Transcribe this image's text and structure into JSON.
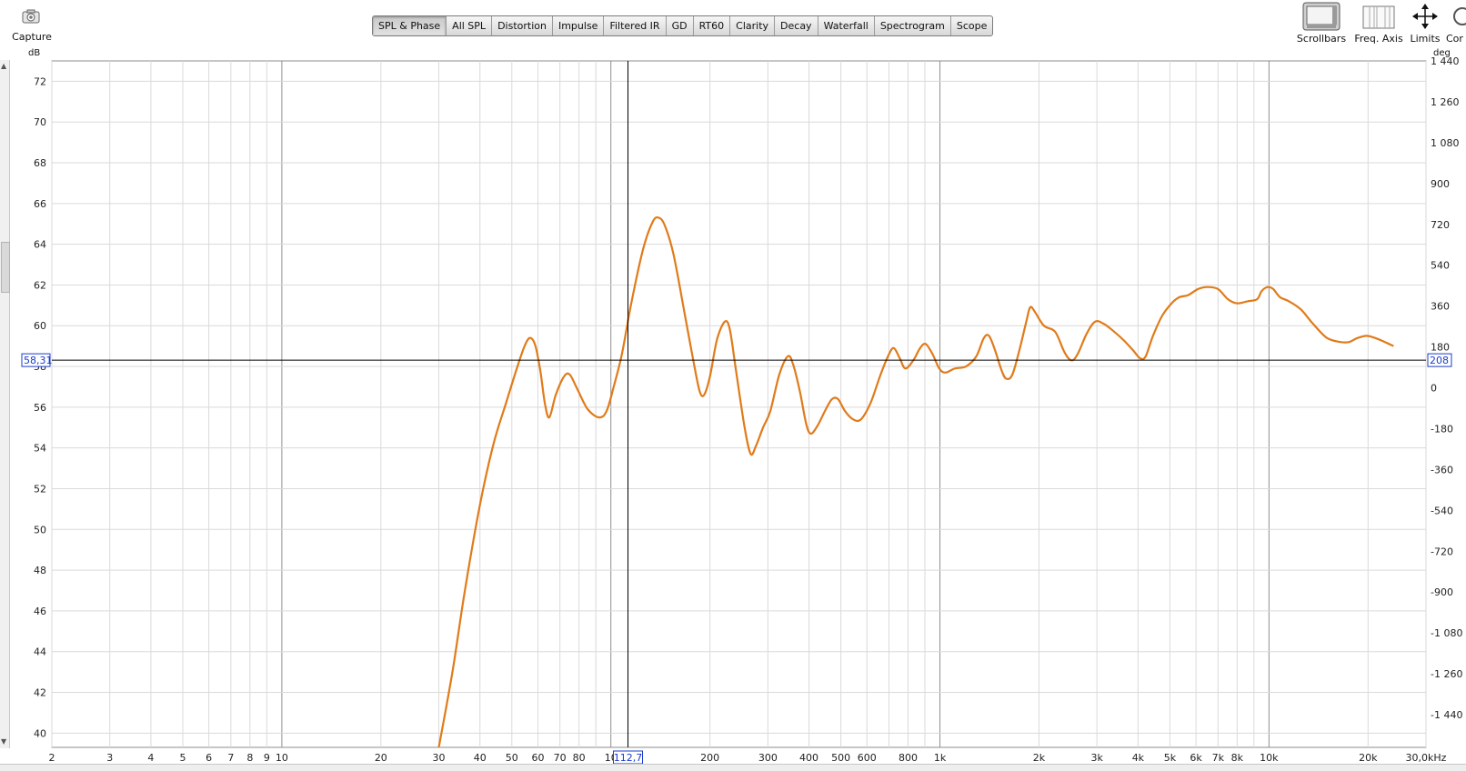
{
  "toolbar": {
    "capture_label": "Capture",
    "tabs": [
      {
        "label": "SPL & Phase",
        "active": true
      },
      {
        "label": "All SPL"
      },
      {
        "label": "Distortion"
      },
      {
        "label": "Impulse"
      },
      {
        "label": "Filtered IR"
      },
      {
        "label": "GD"
      },
      {
        "label": "RT60"
      },
      {
        "label": "Clarity"
      },
      {
        "label": "Decay"
      },
      {
        "label": "Waterfall"
      },
      {
        "label": "Spectrogram"
      },
      {
        "label": "Scope"
      }
    ],
    "right_buttons": [
      {
        "label": "Scrollbars",
        "icon": "scrollbars-icon"
      },
      {
        "label": "Freq. Axis",
        "icon": "freq-axis-icon"
      },
      {
        "label": "Limits",
        "icon": "limits-icon"
      },
      {
        "label": "Cor",
        "icon": "controls-icon"
      }
    ]
  },
  "axes": {
    "left_unit": "dB",
    "right_unit": "deg"
  },
  "cursor": {
    "freq_label": "112,7",
    "spl_label": "58,31",
    "phase_label": "208"
  },
  "colors": {
    "curve": "#e07b1a",
    "grid_major": "#b4b4b4",
    "grid_minor": "#dadada",
    "cursor_label": "#1a3cc8"
  },
  "chart_data": {
    "type": "line",
    "x_scale": "log",
    "xlim": [
      2,
      30000
    ],
    "ylim": [
      39.3,
      73
    ],
    "y2lim": [
      -1584,
      1440
    ],
    "x_ticks": [
      {
        "v": 2,
        "l": "2"
      },
      {
        "v": 3,
        "l": "3"
      },
      {
        "v": 4,
        "l": "4"
      },
      {
        "v": 5,
        "l": "5"
      },
      {
        "v": 6,
        "l": "6"
      },
      {
        "v": 7,
        "l": "7"
      },
      {
        "v": 8,
        "l": "8"
      },
      {
        "v": 9,
        "l": "9"
      },
      {
        "v": 10,
        "l": "10"
      },
      {
        "v": 20,
        "l": "20"
      },
      {
        "v": 30,
        "l": "30"
      },
      {
        "v": 40,
        "l": "40"
      },
      {
        "v": 50,
        "l": "50"
      },
      {
        "v": 60,
        "l": "60"
      },
      {
        "v": 70,
        "l": "70"
      },
      {
        "v": 80,
        "l": "80"
      },
      {
        "v": 100,
        "l": "10"
      },
      {
        "v": 200,
        "l": "200"
      },
      {
        "v": 300,
        "l": "300"
      },
      {
        "v": 400,
        "l": "400"
      },
      {
        "v": 500,
        "l": "500"
      },
      {
        "v": 600,
        "l": "600"
      },
      {
        "v": 800,
        "l": "800"
      },
      {
        "v": 1000,
        "l": "1k"
      },
      {
        "v": 2000,
        "l": "2k"
      },
      {
        "v": 3000,
        "l": "3k"
      },
      {
        "v": 4000,
        "l": "4k"
      },
      {
        "v": 5000,
        "l": "5k"
      },
      {
        "v": 6000,
        "l": "6k"
      },
      {
        "v": 7000,
        "l": "7k"
      },
      {
        "v": 8000,
        "l": "8k"
      },
      {
        "v": 10000,
        "l": "10k"
      },
      {
        "v": 20000,
        "l": "20k"
      },
      {
        "v": 30000,
        "l": "30,0kHz"
      }
    ],
    "y_ticks": [
      {
        "v": 72,
        "l": "72"
      },
      {
        "v": 70,
        "l": "70"
      },
      {
        "v": 68,
        "l": "68"
      },
      {
        "v": 66,
        "l": "66"
      },
      {
        "v": 64,
        "l": "64"
      },
      {
        "v": 62,
        "l": "62"
      },
      {
        "v": 60,
        "l": "60"
      },
      {
        "v": 58,
        "l": "58"
      },
      {
        "v": 56,
        "l": "56"
      },
      {
        "v": 54,
        "l": "54"
      },
      {
        "v": 52,
        "l": "52"
      },
      {
        "v": 50,
        "l": "50"
      },
      {
        "v": 48,
        "l": "48"
      },
      {
        "v": 46,
        "l": "46"
      },
      {
        "v": 44,
        "l": "44"
      },
      {
        "v": 42,
        "l": "42"
      },
      {
        "v": 40,
        "l": "40"
      }
    ],
    "y2_ticks": [
      {
        "v": 1440,
        "l": "1 440"
      },
      {
        "v": 1260,
        "l": "1 260"
      },
      {
        "v": 1080,
        "l": "1 080"
      },
      {
        "v": 900,
        "l": "900"
      },
      {
        "v": 720,
        "l": "720"
      },
      {
        "v": 540,
        "l": "540"
      },
      {
        "v": 360,
        "l": "360"
      },
      {
        "v": 180,
        "l": "180"
      },
      {
        "v": 0,
        "l": "0"
      },
      {
        "v": -180,
        "l": "-180"
      },
      {
        "v": -360,
        "l": "-360"
      },
      {
        "v": -540,
        "l": "-540"
      },
      {
        "v": -720,
        "l": "-720"
      },
      {
        "v": -900,
        "l": "-900"
      },
      {
        "v": -1080,
        "l": "-1 080"
      },
      {
        "v": -1260,
        "l": "-1 260"
      },
      {
        "v": -1440,
        "l": "-1 440"
      }
    ],
    "cursor": {
      "x": 112.7,
      "y": 58.31
    },
    "series": [
      {
        "points": [
          [
            30,
            39.3
          ],
          [
            33,
            43.0
          ],
          [
            36,
            47.0
          ],
          [
            40,
            51.2
          ],
          [
            44,
            54.2
          ],
          [
            48,
            56.2
          ],
          [
            52,
            58.0
          ],
          [
            55,
            59.1
          ],
          [
            57,
            59.4
          ],
          [
            59,
            59.0
          ],
          [
            61,
            57.8
          ],
          [
            63,
            56.2
          ],
          [
            65,
            55.5
          ],
          [
            68,
            56.6
          ],
          [
            72,
            57.5
          ],
          [
            75,
            57.6
          ],
          [
            79,
            56.9
          ],
          [
            85,
            55.9
          ],
          [
            92,
            55.5
          ],
          [
            97,
            55.8
          ],
          [
            102,
            57.0
          ],
          [
            108,
            58.6
          ],
          [
            115,
            61.0
          ],
          [
            125,
            63.7
          ],
          [
            134,
            65.1
          ],
          [
            140,
            65.3
          ],
          [
            146,
            64.9
          ],
          [
            155,
            63.5
          ],
          [
            168,
            60.5
          ],
          [
            178,
            58.3
          ],
          [
            186,
            56.8
          ],
          [
            192,
            56.6
          ],
          [
            200,
            57.5
          ],
          [
            210,
            59.3
          ],
          [
            222,
            60.2
          ],
          [
            230,
            59.8
          ],
          [
            240,
            57.8
          ],
          [
            255,
            55.0
          ],
          [
            266,
            53.7
          ],
          [
            276,
            54.1
          ],
          [
            290,
            55.0
          ],
          [
            305,
            55.8
          ],
          [
            325,
            57.6
          ],
          [
            345,
            58.5
          ],
          [
            358,
            58.1
          ],
          [
            375,
            56.8
          ],
          [
            392,
            55.2
          ],
          [
            405,
            54.7
          ],
          [
            425,
            55.1
          ],
          [
            450,
            55.9
          ],
          [
            470,
            56.4
          ],
          [
            490,
            56.4
          ],
          [
            515,
            55.8
          ],
          [
            545,
            55.4
          ],
          [
            575,
            55.4
          ],
          [
            615,
            56.2
          ],
          [
            660,
            57.6
          ],
          [
            700,
            58.6
          ],
          [
            725,
            58.9
          ],
          [
            755,
            58.4
          ],
          [
            785,
            57.9
          ],
          [
            830,
            58.3
          ],
          [
            870,
            58.9
          ],
          [
            905,
            59.1
          ],
          [
            950,
            58.6
          ],
          [
            995,
            57.9
          ],
          [
            1040,
            57.7
          ],
          [
            1110,
            57.9
          ],
          [
            1200,
            58.0
          ],
          [
            1290,
            58.5
          ],
          [
            1360,
            59.4
          ],
          [
            1410,
            59.5
          ],
          [
            1470,
            58.8
          ],
          [
            1540,
            57.8
          ],
          [
            1590,
            57.4
          ],
          [
            1660,
            57.6
          ],
          [
            1750,
            58.9
          ],
          [
            1830,
            60.2
          ],
          [
            1880,
            60.9
          ],
          [
            1940,
            60.7
          ],
          [
            2070,
            60.0
          ],
          [
            2240,
            59.7
          ],
          [
            2390,
            58.7
          ],
          [
            2510,
            58.3
          ],
          [
            2620,
            58.6
          ],
          [
            2790,
            59.6
          ],
          [
            2960,
            60.2
          ],
          [
            3140,
            60.1
          ],
          [
            3330,
            59.8
          ],
          [
            3610,
            59.3
          ],
          [
            3860,
            58.8
          ],
          [
            4060,
            58.4
          ],
          [
            4220,
            58.5
          ],
          [
            4440,
            59.5
          ],
          [
            4740,
            60.5
          ],
          [
            5060,
            61.1
          ],
          [
            5340,
            61.4
          ],
          [
            5680,
            61.5
          ],
          [
            6090,
            61.8
          ],
          [
            6500,
            61.9
          ],
          [
            7000,
            61.8
          ],
          [
            7500,
            61.3
          ],
          [
            8000,
            61.1
          ],
          [
            8600,
            61.2
          ],
          [
            9200,
            61.3
          ],
          [
            9500,
            61.7
          ],
          [
            9900,
            61.9
          ],
          [
            10300,
            61.8
          ],
          [
            10800,
            61.4
          ],
          [
            11500,
            61.2
          ],
          [
            12500,
            60.8
          ],
          [
            13600,
            60.1
          ],
          [
            15000,
            59.4
          ],
          [
            16500,
            59.2
          ],
          [
            17500,
            59.2
          ],
          [
            18600,
            59.4
          ],
          [
            19800,
            59.5
          ],
          [
            21000,
            59.4
          ],
          [
            22500,
            59.2
          ],
          [
            23900,
            59.0
          ]
        ]
      }
    ]
  }
}
